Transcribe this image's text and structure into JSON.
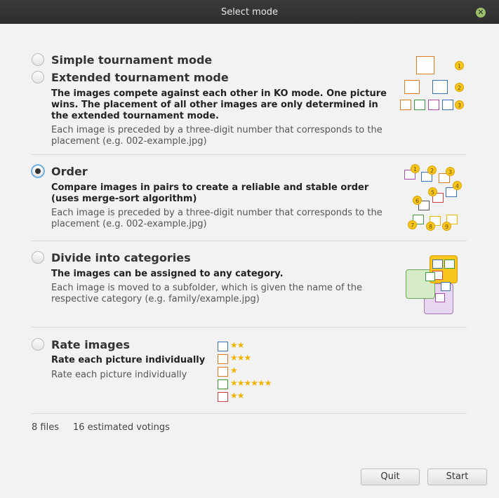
{
  "window": {
    "title": "Select mode"
  },
  "modes": [
    {
      "title": "Simple tournament mode",
      "checked": false
    },
    {
      "title": "Extended tournament mode",
      "checked": false,
      "desc_bold": "The images compete against each other in KO mode. One picture wins. The placement of all other images are only determined in the extended tournament mode.",
      "desc": "Each image is preceded by a three-digit number that corresponds to the placement (e.g. 002-example.jpg)"
    },
    {
      "title": "Order",
      "checked": true,
      "desc_bold": "Compare images in pairs to create a reliable and stable order (uses merge-sort algorithm)",
      "desc": "Each image is preceded by a three-digit number that corresponds to the placement (e.g. 002-example.jpg)"
    },
    {
      "title": "Divide into categories",
      "checked": false,
      "desc_bold": "The images can be assigned to any category.",
      "desc": "Each image is moved to a subfolder, which is given the name of the respective category (e.g. family/example.jpg)"
    },
    {
      "title": "Rate images",
      "checked": false,
      "desc_bold": "Rate each picture individually",
      "desc": "Rate each picture individually"
    }
  ],
  "tournament_badges": [
    "1",
    "2",
    "3"
  ],
  "order_badges": [
    "1",
    "2",
    "3",
    "4",
    "5",
    "6",
    "7",
    "8",
    "9"
  ],
  "rating_stars": [
    {
      "stars": "★★",
      "count": 2
    },
    {
      "stars": "★★★",
      "count": 3
    },
    {
      "stars": "★",
      "count": 1
    },
    {
      "stars": "★★★★★★",
      "count": 6
    },
    {
      "stars": "★★",
      "count": 2
    }
  ],
  "footer": {
    "files": "8 files",
    "votings": "16 estimated votings"
  },
  "buttons": {
    "quit": "Quit",
    "start": "Start"
  },
  "icons": {
    "close": "close-icon",
    "image": "image-icon",
    "star": "star-icon"
  },
  "colors": {
    "accent": "#5aa0d8",
    "badge": "#f8c51c",
    "star": "#f0b400",
    "orange": "#e07b20",
    "blue": "#3b6fb6",
    "green": "#3c9a3c",
    "purple": "#b04ab0",
    "red": "#d04040"
  }
}
